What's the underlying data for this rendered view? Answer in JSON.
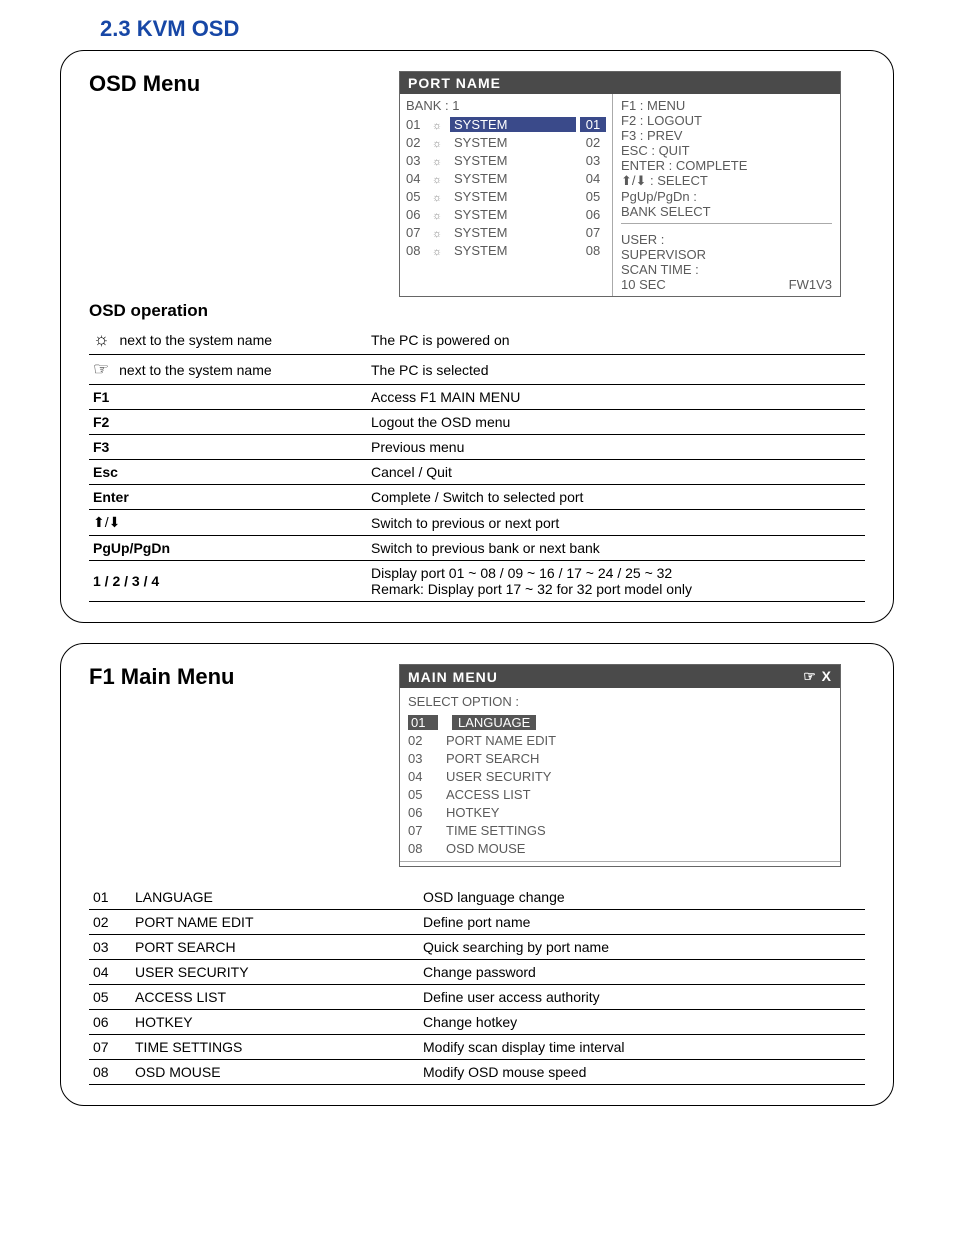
{
  "section_title": "2.3  KVM OSD",
  "panel1": {
    "title": "OSD Menu",
    "subtitle": "OSD operation",
    "osd_header": "PORT  NAME",
    "bank": "BANK : 1",
    "ports": [
      {
        "idx": "01",
        "name": "SYSTEM",
        "num": "01",
        "selected": true
      },
      {
        "idx": "02",
        "name": "SYSTEM",
        "num": "02",
        "selected": false
      },
      {
        "idx": "03",
        "name": "SYSTEM",
        "num": "03",
        "selected": false
      },
      {
        "idx": "04",
        "name": "SYSTEM",
        "num": "04",
        "selected": false
      },
      {
        "idx": "05",
        "name": "SYSTEM",
        "num": "05",
        "selected": false
      },
      {
        "idx": "06",
        "name": "SYSTEM",
        "num": "06",
        "selected": false
      },
      {
        "idx": "07",
        "name": "SYSTEM",
        "num": "07",
        "selected": false
      },
      {
        "idx": "08",
        "name": "SYSTEM",
        "num": "08",
        "selected": false
      }
    ],
    "help_lines": [
      "F1 : MENU",
      "F2 : LOGOUT",
      "F3 : PREV",
      "ESC : QUIT",
      "ENTER : COMPLETE",
      "⬆/⬇ : SELECT",
      "PgUp/PgDn :",
      "BANK SELECT"
    ],
    "status": {
      "user_label": "USER :",
      "user": "SUPERVISOR",
      "scan_label": "SCAN TIME :",
      "scan": "10 SEC",
      "fw": "FW1V3"
    },
    "legend": [
      {
        "iconClass": "sun-big",
        "key": "next to the system name",
        "desc": "The PC is powered on"
      },
      {
        "iconClass": "hand",
        "key": "next to the system name",
        "desc": "The PC is selected"
      },
      {
        "key": "F1",
        "desc": "Access F1 MAIN MENU",
        "bold": true
      },
      {
        "key": "F2",
        "desc": "Logout the OSD menu",
        "bold": true
      },
      {
        "key": "F3",
        "desc": "Previous menu",
        "bold": true
      },
      {
        "key": "Esc",
        "desc": "Cancel / Quit",
        "bold": true
      },
      {
        "key": "Enter",
        "desc": "Complete / Switch to selected port",
        "bold": true
      },
      {
        "iconClass": "arrows",
        "key": "",
        "desc": "Switch to previous or next port"
      },
      {
        "key": "PgUp/PgDn",
        "desc": "Switch to previous bank or next bank",
        "bold": true
      },
      {
        "key": "1 / 2 / 3 / 4",
        "desc": "Display port  01 ~ 08 / 09 ~ 16 / 17 ~ 24 / 25 ~ 32\nRemark:  Display port 17 ~ 32 for 32 port model only",
        "bold": true
      }
    ]
  },
  "panel2": {
    "title": "F1 Main Menu",
    "mm_header": "MAIN  MENU",
    "select_label": "SELECT OPTION :",
    "options": [
      {
        "num": "01",
        "name": "LANGUAGE",
        "selected": true
      },
      {
        "num": "02",
        "name": "PORT NAME  EDIT",
        "selected": false
      },
      {
        "num": "03",
        "name": "PORT SEARCH",
        "selected": false
      },
      {
        "num": "04",
        "name": "USER SECURITY",
        "selected": false
      },
      {
        "num": "05",
        "name": "ACCESS LIST",
        "selected": false
      },
      {
        "num": "06",
        "name": "HOTKEY",
        "selected": false
      },
      {
        "num": "07",
        "name": "TIME SETTINGS",
        "selected": false
      },
      {
        "num": "08",
        "name": "OSD MOUSE",
        "selected": false
      }
    ],
    "legend": [
      {
        "num": "01",
        "name": "LANGUAGE",
        "desc": "OSD language change"
      },
      {
        "num": "02",
        "name": "PORT NAME EDIT",
        "desc": "Define port name"
      },
      {
        "num": "03",
        "name": "PORT SEARCH",
        "desc": "Quick searching by port name"
      },
      {
        "num": "04",
        "name": "USER SECURITY",
        "desc": "Change password"
      },
      {
        "num": "05",
        "name": "ACCESS LIST",
        "desc": "Define user access authority"
      },
      {
        "num": "06",
        "name": "HOTKEY",
        "desc": "Change hotkey"
      },
      {
        "num": "07",
        "name": "TIME SETTINGS",
        "desc": "Modify scan display time interval"
      },
      {
        "num": "08",
        "name": "OSD MOUSE",
        "desc": "Modify OSD mouse speed"
      }
    ]
  }
}
